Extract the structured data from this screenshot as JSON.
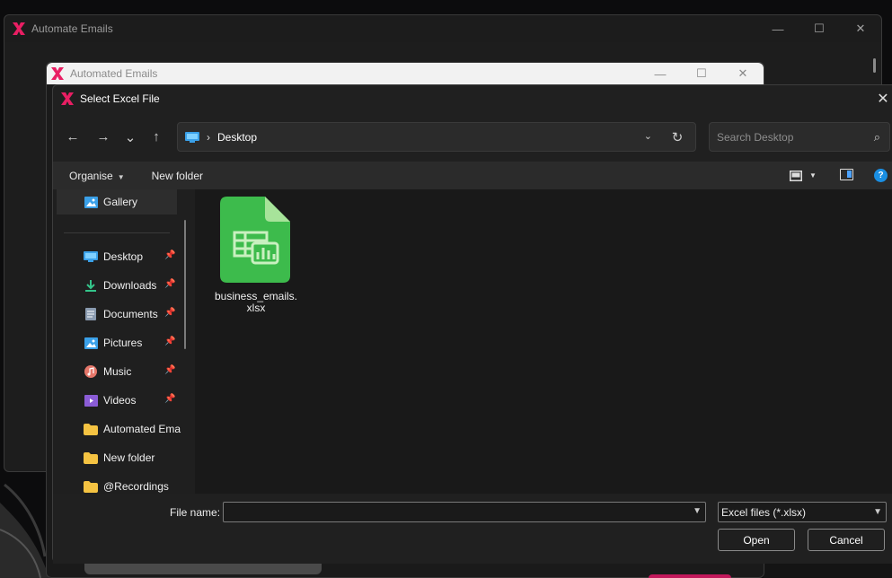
{
  "background_window": {
    "title": "Automate Emails",
    "controls": [
      "—",
      "☐",
      "✕"
    ]
  },
  "middle_window": {
    "title": "Automated Emails",
    "controls": [
      "—",
      "☐",
      "✕"
    ]
  },
  "dialog": {
    "title": "Select Excel File",
    "close": "✕",
    "nav": {
      "back": "←",
      "forward": "→",
      "recent": "⌄",
      "up": "↑"
    },
    "address": {
      "separator": "›",
      "location": "Desktop",
      "dropdown": "⌄",
      "refresh": "↻"
    },
    "search": {
      "placeholder": "Search Desktop",
      "icon": "⌕"
    },
    "command_bar": {
      "organise": "Organise",
      "new_folder": "New folder",
      "help": "?"
    },
    "nav_pane": {
      "gallery": "Gallery",
      "items": [
        {
          "label": "Desktop",
          "icon": "desktop-icon",
          "pinned": true
        },
        {
          "label": "Downloads",
          "icon": "download-icon",
          "pinned": true
        },
        {
          "label": "Documents",
          "icon": "document-icon",
          "pinned": true
        },
        {
          "label": "Pictures",
          "icon": "picture-icon",
          "pinned": true
        },
        {
          "label": "Music",
          "icon": "music-icon",
          "pinned": true
        },
        {
          "label": "Videos",
          "icon": "video-icon",
          "pinned": true
        },
        {
          "label": "Automated Ema",
          "icon": "folder-icon",
          "pinned": false
        },
        {
          "label": "New folder",
          "icon": "folder-icon",
          "pinned": false
        },
        {
          "label": "@Recordings",
          "icon": "folder-icon",
          "pinned": false
        }
      ]
    },
    "files": [
      {
        "name_line1": "business_emails.",
        "name_line2": "xlsx",
        "icon": "excel-file-icon"
      }
    ],
    "footer": {
      "file_name_label": "File name:",
      "file_name_value": "",
      "file_type": "Excel files (*.xlsx)",
      "open": "Open",
      "cancel": "Cancel"
    }
  },
  "colors": {
    "accent": "#e91e63",
    "excel_green": "#3dbb4c",
    "link_blue": "#1a8fe3"
  }
}
